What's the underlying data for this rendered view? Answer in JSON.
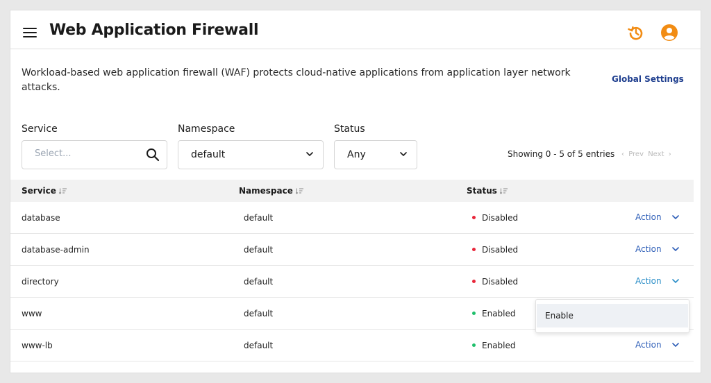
{
  "header": {
    "title": "Web Application Firewall",
    "history_icon": "history-icon",
    "user_icon": "user-account-icon",
    "accent_color": "#f28c13"
  },
  "description": "Workload-based web application firewall (WAF) protects cloud-native applications from application layer network attacks.",
  "global_settings_label": "Global Settings",
  "filters": {
    "service": {
      "label": "Service",
      "placeholder": "Select...",
      "value": ""
    },
    "namespace": {
      "label": "Namespace",
      "value": "default"
    },
    "status": {
      "label": "Status",
      "value": "Any"
    }
  },
  "pagination": {
    "showing": "Showing 0 - 5 of 5 entries",
    "prev": "Prev",
    "next": "Next"
  },
  "table": {
    "columns": [
      "Service",
      "Namespace",
      "Status"
    ],
    "action_label": "Action",
    "rows": [
      {
        "service": "database",
        "namespace": "default",
        "status": "Disabled",
        "status_color": "#e8263a"
      },
      {
        "service": "database-admin",
        "namespace": "default",
        "status": "Disabled",
        "status_color": "#e8263a"
      },
      {
        "service": "directory",
        "namespace": "default",
        "status": "Disabled",
        "status_color": "#e8263a"
      },
      {
        "service": "www",
        "namespace": "default",
        "status": "Enabled",
        "status_color": "#1fbf6b"
      },
      {
        "service": "www-lb",
        "namespace": "default",
        "status": "Enabled",
        "status_color": "#1fbf6b"
      }
    ]
  },
  "action_menu": {
    "items": [
      "Enable"
    ]
  }
}
